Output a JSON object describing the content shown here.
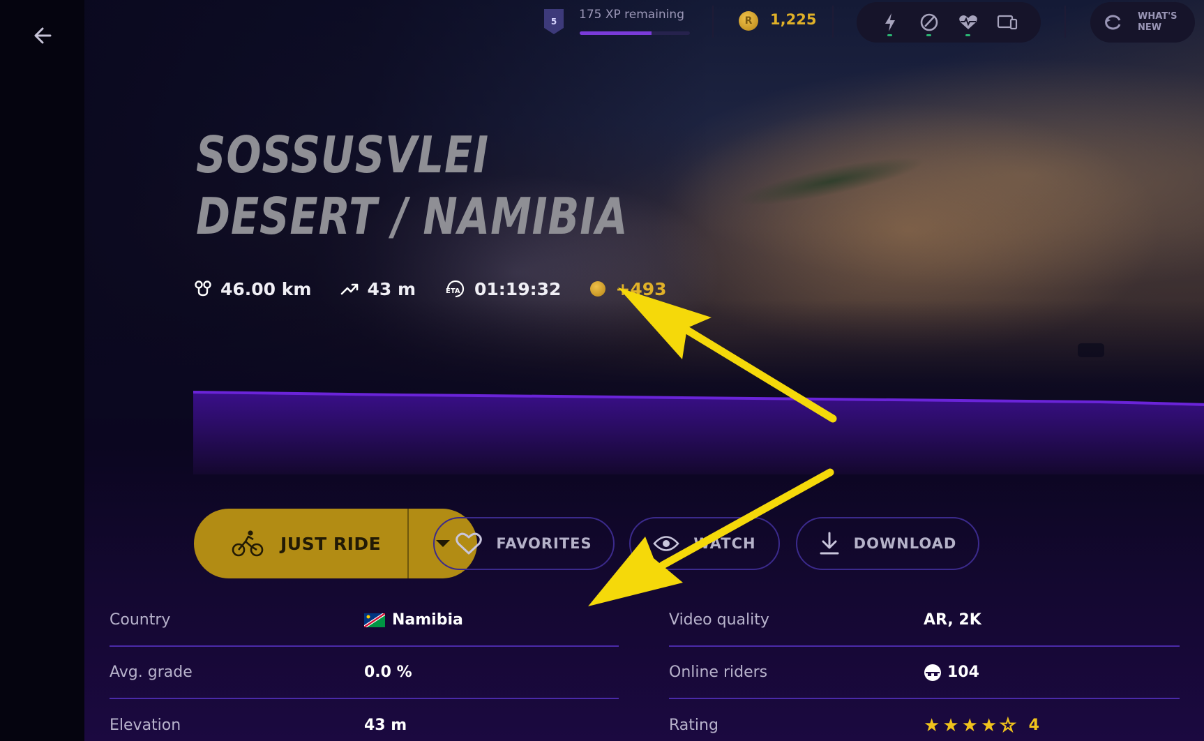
{
  "topbar": {
    "level": "5",
    "xp_remaining": "175 XP remaining",
    "xp_progress": 0.65,
    "coin_symbol": "R",
    "coins": "1,225",
    "devices": [
      {
        "icon": "power-meter-icon",
        "connected": true
      },
      {
        "icon": "speed-sensor-icon",
        "connected": true
      },
      {
        "icon": "heart-rate-icon",
        "connected": true
      },
      {
        "icon": "devices-icon",
        "connected": false
      }
    ],
    "whats_new": "WHAT'S NEW"
  },
  "route": {
    "title": "SOSSUSVLEI DESERT / NAMIBIA",
    "distance": "46.00 km",
    "elevation_gain": "43 m",
    "eta": "01:19:32",
    "coin_reward": "+493"
  },
  "actions": {
    "just_ride": "JUST RIDE",
    "favorites": "FAVORITES",
    "watch": "WATCH",
    "download": "DOWNLOAD"
  },
  "details": {
    "left": [
      {
        "label": "Country",
        "value": "Namibia"
      },
      {
        "label": "Avg. grade",
        "value": "0.0 %"
      },
      {
        "label": "Elevation",
        "value": "43 m"
      }
    ],
    "right": [
      {
        "label": "Video quality",
        "value": "AR, 2K"
      },
      {
        "label": "Online riders",
        "value": "104"
      },
      {
        "label": "Rating",
        "value": "4",
        "stars_filled": 4,
        "stars_total": 5
      }
    ]
  },
  "colors": {
    "accent_gold": "#b28c14",
    "coin": "#e0b128",
    "purple_line": "#4a2aa8",
    "annotation_arrow": "#f5d90a"
  }
}
